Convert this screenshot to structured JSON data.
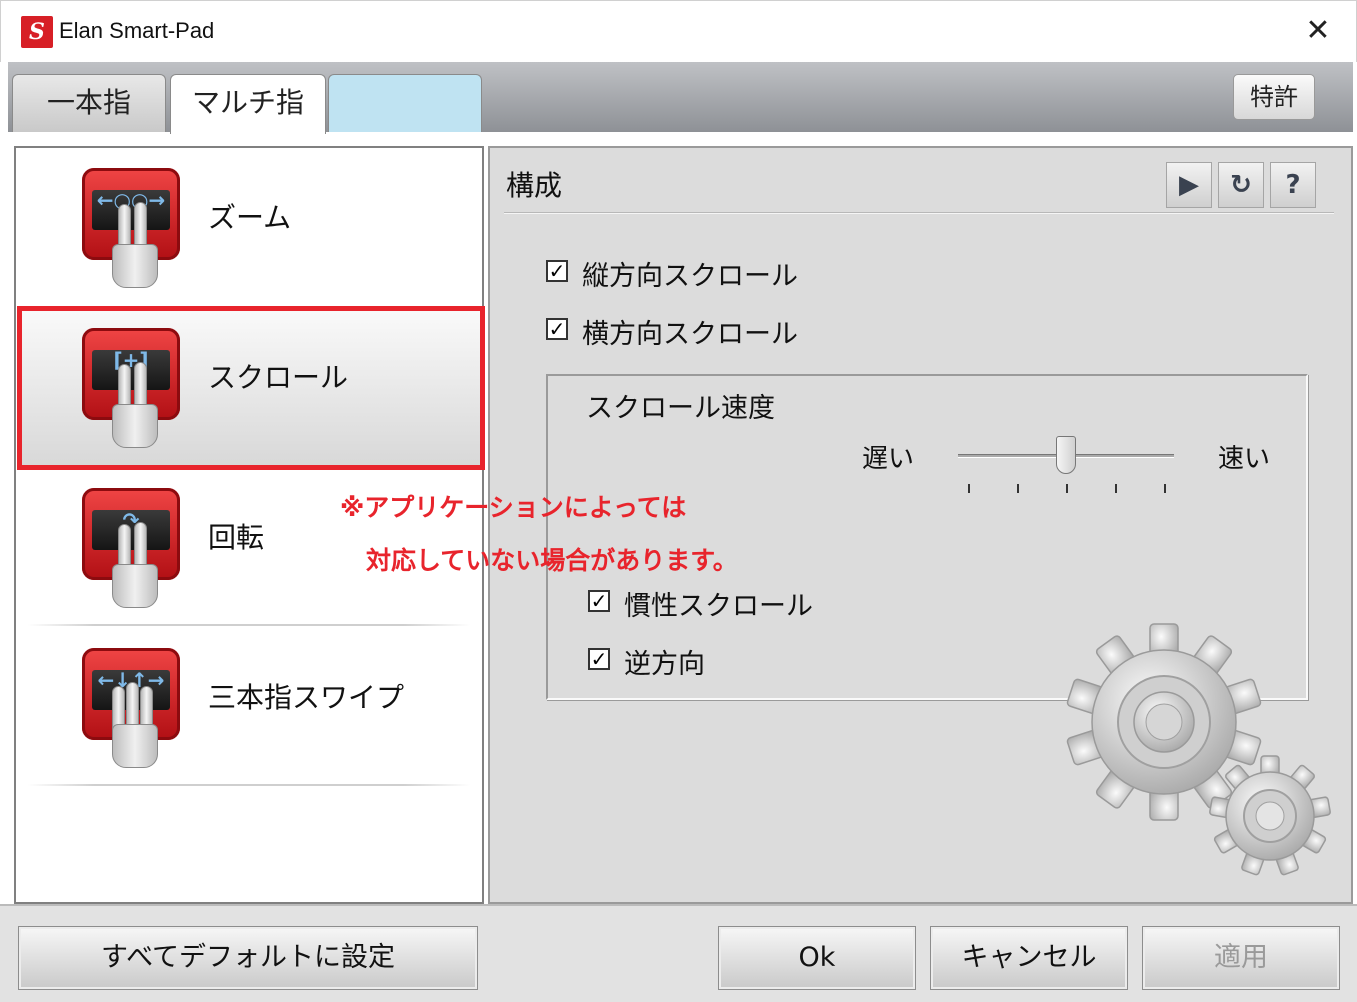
{
  "window": {
    "title": "Elan Smart-Pad",
    "close_glyph": "✕"
  },
  "tabs": [
    {
      "label": "一本指"
    },
    {
      "label": "マルチ指"
    },
    {
      "label": ""
    }
  ],
  "patent_button": "特許",
  "gestures": [
    {
      "label": "ズーム",
      "icon": "zoom-gesture-icon",
      "glyph": "←○○→"
    },
    {
      "label": "スクロール",
      "icon": "scroll-gesture-icon",
      "glyph": "[+]"
    },
    {
      "label": "回転",
      "icon": "rotate-gesture-icon",
      "glyph": "↷"
    },
    {
      "label": "三本指スワイプ",
      "icon": "swipe-gesture-icon",
      "glyph": "←↓↑→"
    }
  ],
  "selected_gesture": "スクロール",
  "annotation": {
    "line1": "※アプリケーションによっては",
    "line2": "対応していない場合があります。"
  },
  "config": {
    "title": "構成",
    "play_glyph": "▶",
    "refresh_glyph": "↻",
    "help_glyph": "?",
    "vertical_scroll": {
      "label": "縦方向スクロール",
      "checked": true
    },
    "horizontal_scroll": {
      "label": "横方向スクロール",
      "checked": true
    },
    "speed": {
      "title": "スクロール速度",
      "slow_label": "遅い",
      "fast_label": "速い",
      "level": 0.5
    },
    "inertia_scroll": {
      "label": "慣性スクロール",
      "checked": true
    },
    "reverse": {
      "label": "逆方向",
      "checked": true
    },
    "check_glyph": "✓"
  },
  "buttons": {
    "default": "すべてデフォルトに設定",
    "ok": "Ok",
    "cancel": "キャンセル",
    "apply": "適用"
  }
}
